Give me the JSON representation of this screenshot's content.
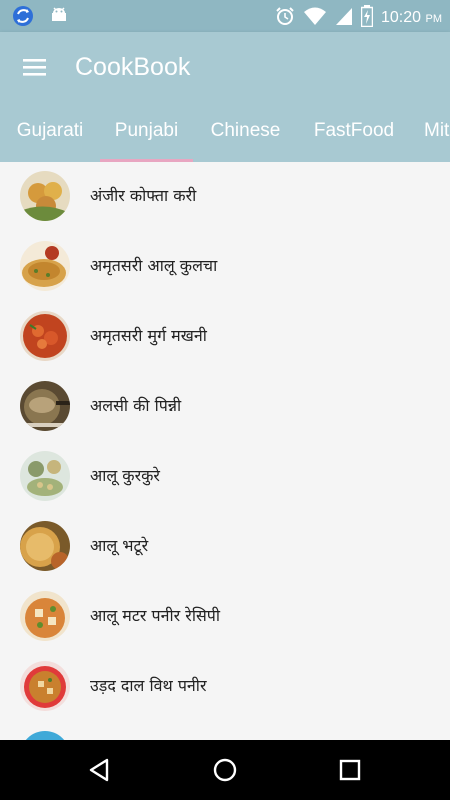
{
  "status_bar": {
    "time": "10:20",
    "ampm": "PM",
    "icons": [
      "sync-icon",
      "android-icon",
      "alarm-icon",
      "wifi-icon",
      "signal-icon",
      "battery-icon"
    ]
  },
  "app_bar": {
    "title": "CookBook",
    "menu_icon": "hamburger-menu-icon",
    "background": "#a8c9d2"
  },
  "tabs": [
    {
      "label": "Gujarati",
      "active": false
    },
    {
      "label": "Punjabi",
      "active": true
    },
    {
      "label": "Chinese",
      "active": false
    },
    {
      "label": "FastFood",
      "active": false
    },
    {
      "label": "Mit",
      "active": false
    }
  ],
  "accent_color": "#e8a6c1",
  "recipes": [
    {
      "name": "अंजीर कोफ्ता करी",
      "thumb_color": "#c88a3a"
    },
    {
      "name": "अमृतसरी आलू कुलचा",
      "thumb_color": "#d7a24a"
    },
    {
      "name": "अमृतसरी मुर्ग मखनी",
      "thumb_color": "#c1441f"
    },
    {
      "name": "अलसी की पिन्नी",
      "thumb_color": "#8a7650"
    },
    {
      "name": "आलू कुरकुरे",
      "thumb_color": "#8a9a6a"
    },
    {
      "name": "आलू भटूरे",
      "thumb_color": "#d8a24a"
    },
    {
      "name": "आलू मटर पनीर रेसिपी",
      "thumb_color": "#d9853a"
    },
    {
      "name": "उड़द दाल विथ पनीर",
      "thumb_color": "#c9802e"
    }
  ],
  "nav_bar": {
    "icons": [
      "back-icon",
      "home-icon",
      "recents-icon"
    ]
  }
}
